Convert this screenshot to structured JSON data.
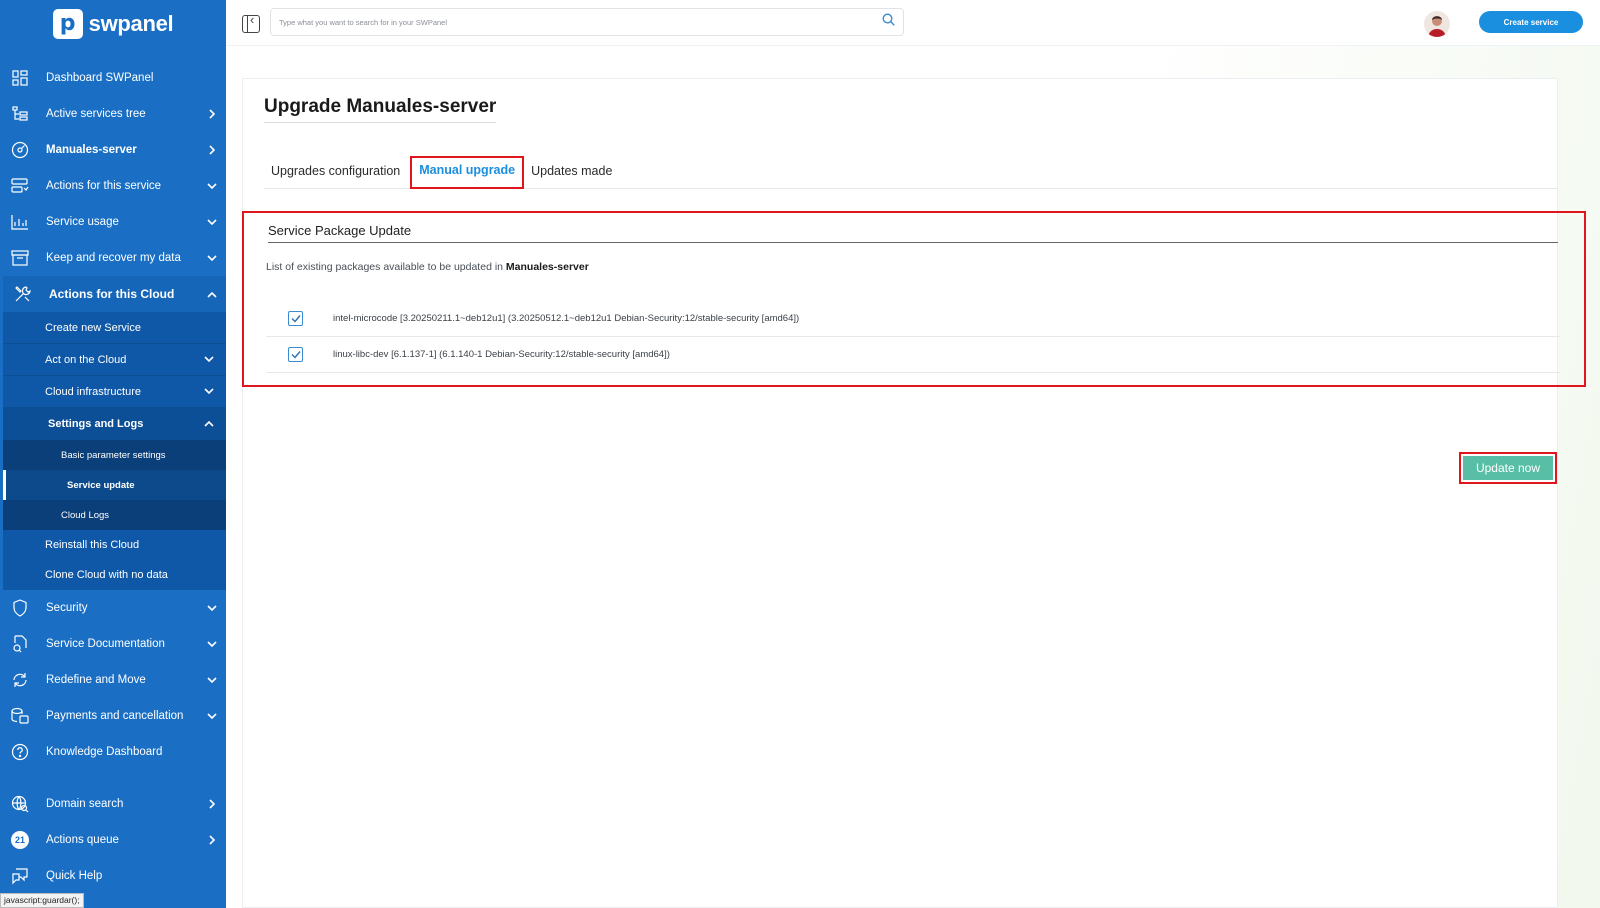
{
  "brand": {
    "name": "swpanel",
    "mark": "p"
  },
  "search": {
    "placeholder": "Type what you want to search for in your SWPanel"
  },
  "header": {
    "create_service_label": "Create service"
  },
  "sidebar": {
    "items": [
      {
        "label": "Dashboard SWPanel",
        "icon": "dashboard-icon"
      },
      {
        "label": "Active services tree",
        "icon": "tree-icon"
      },
      {
        "label": "Manuales-server",
        "icon": "disk-icon"
      },
      {
        "label": "Actions for this service",
        "icon": "server-actions-icon"
      },
      {
        "label": "Service usage",
        "icon": "chart-icon"
      },
      {
        "label": "Keep and recover my data",
        "icon": "archive-icon"
      },
      {
        "label": "Actions for this Cloud",
        "icon": "tools-icon"
      }
    ],
    "cloud_sub": [
      {
        "label": "Create new Service"
      },
      {
        "label": "Act on the Cloud"
      },
      {
        "label": "Cloud infrastructure"
      },
      {
        "label": "Settings and Logs"
      }
    ],
    "settings_sub": [
      {
        "label": "Basic parameter settings"
      },
      {
        "label": "Service update"
      },
      {
        "label": "Cloud Logs"
      }
    ],
    "cloud_more": [
      {
        "label": "Reinstall this Cloud"
      },
      {
        "label": "Clone Cloud with no data"
      }
    ],
    "lower_items": [
      {
        "label": "Security",
        "icon": "shield-icon"
      },
      {
        "label": "Service Documentation",
        "icon": "document-icon"
      },
      {
        "label": "Redefine and Move",
        "icon": "refresh-icon"
      },
      {
        "label": "Payments and cancellation",
        "icon": "payments-icon"
      },
      {
        "label": "Knowledge Dashboard",
        "icon": "help-circle-icon"
      }
    ],
    "bottom_items": [
      {
        "label": "Domain search",
        "icon": "globe-search-icon"
      },
      {
        "label": "Actions queue",
        "badge": "21"
      },
      {
        "label": "Quick Help",
        "icon": "chat-icon"
      }
    ]
  },
  "status_bar": {
    "text": "javascript:guardar();"
  },
  "main": {
    "title": "Upgrade Manuales-server",
    "tabs": [
      {
        "label": "Upgrades configuration"
      },
      {
        "label": "Manual upgrade"
      },
      {
        "label": "Updates made"
      }
    ],
    "section_title": "Service Package Update",
    "description_prefix": "List of existing packages available to be updated in",
    "description_server": "Manuales-server",
    "packages": [
      {
        "text": "intel-microcode [3.20250211.1~deb12u1] (3.20250512.1~deb12u1 Debian-Security:12/stable-security [amd64])",
        "checked": true
      },
      {
        "text": "linux-libc-dev [6.1.137-1] (6.1.140-1 Debian-Security:12/stable-security [amd64])",
        "checked": true
      }
    ],
    "update_button_label": "Update now"
  },
  "colors": {
    "sidebar": "#1a6fc4",
    "accent": "#1a8fe0",
    "highlight": "#e0161f",
    "update_button": "#58bfa6"
  }
}
